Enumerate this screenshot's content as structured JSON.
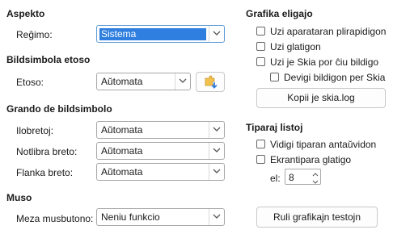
{
  "left": {
    "aspekto": {
      "heading": "Aspekto",
      "regimo_label": "Reĝimo:",
      "regimo_value": "Sistema"
    },
    "bildsimbola_etoso": {
      "heading": "Bildsimbola etoso",
      "etoso_label": "Etoso:",
      "etoso_value": "Aŭtomata"
    },
    "grando": {
      "heading": "Grando de bildsimbolo",
      "ilobretoj_label": "Ilobretoj:",
      "ilobretoj_value": "Aŭtomata",
      "notlibra_label": "Notlibra breto:",
      "notlibra_value": "Aŭtomata",
      "flanka_label": "Flanka breto:",
      "flanka_value": "Aŭtomata"
    },
    "muso": {
      "heading": "Muso",
      "meza_label": "Meza musbutono:",
      "meza_value": "Neniu funkcio"
    }
  },
  "right": {
    "grafika": {
      "heading": "Grafika eligajo",
      "opt1": "Uzi aparataran plirapidigon",
      "opt2": "Uzi glatigon",
      "opt3": "Uzi je Skia por ĉiu bildigo",
      "opt4": "Devigi bildigon per Skia",
      "copy_button": "Kopii je skia.log"
    },
    "tiparaj": {
      "heading": "Tiparaj listoj",
      "opt1": "Vidigi tiparan antaŭvidon",
      "opt2": "Ekrantipara glatigo",
      "el_label": "el:",
      "el_value": "8"
    },
    "test_button": "Ruli grafikajn testojn"
  },
  "icons": {
    "dropdown": "chevron-down-icon",
    "theme_extension": "puzzle-download-icon"
  },
  "colors": {
    "accent": "#2f7fe0",
    "focus_border": "#5b9bd5"
  }
}
